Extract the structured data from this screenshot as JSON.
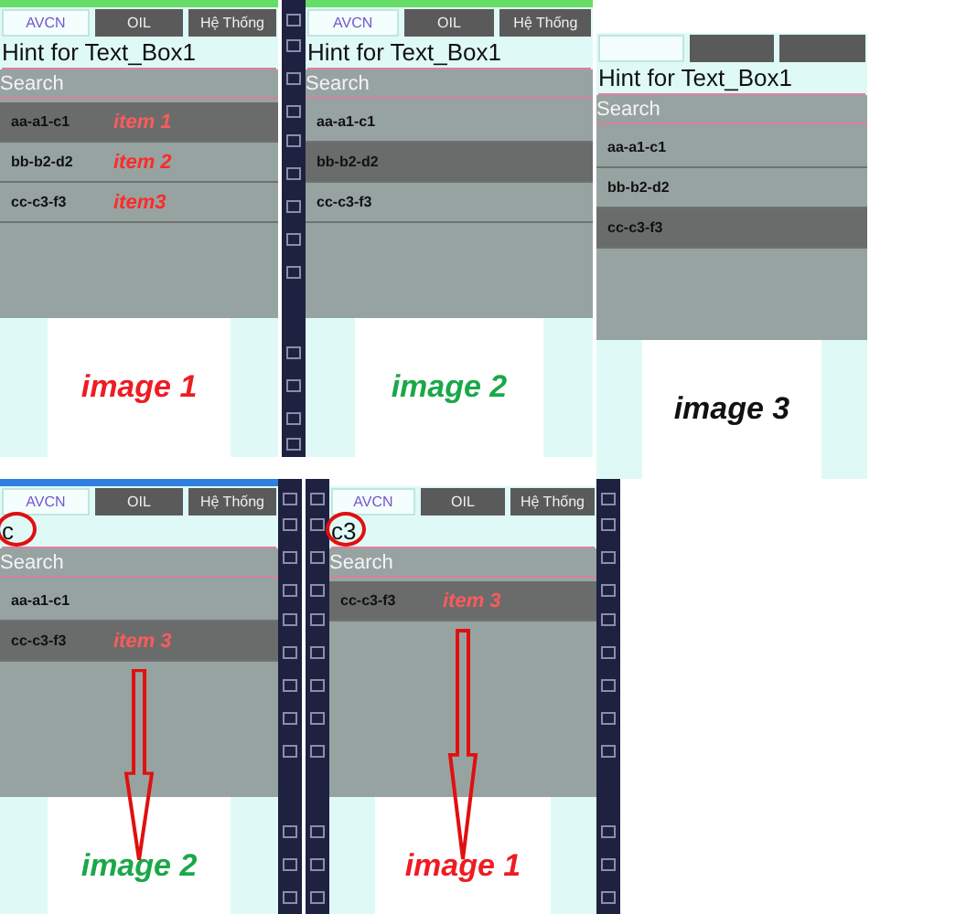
{
  "panels": [
    {
      "tabs": [
        {
          "label": "AVCN",
          "selected": true
        },
        {
          "label": "OIL",
          "selected": false
        },
        {
          "label": "Hệ Thống",
          "selected": false
        }
      ],
      "field": {
        "placeholder": "Hint for Text_Box1"
      },
      "search": {
        "placeholder": "Search"
      },
      "items": [
        {
          "label": "aa-a1-c1",
          "selected": true,
          "note": "item 1"
        },
        {
          "label": "bb-b2-d2",
          "selected": false,
          "note": "item 2"
        },
        {
          "label": "cc-c3-f3",
          "selected": false,
          "note": "item3"
        }
      ],
      "caption": {
        "text": "image 1",
        "color": "#ee1c24"
      }
    },
    {
      "tabs": [
        {
          "label": "AVCN",
          "selected": true
        },
        {
          "label": "OIL",
          "selected": false
        },
        {
          "label": "Hệ Thống",
          "selected": false
        }
      ],
      "field": {
        "placeholder": "Hint for Text_Box1"
      },
      "search": {
        "placeholder": "Search"
      },
      "items": [
        {
          "label": "aa-a1-c1",
          "selected": false
        },
        {
          "label": "bb-b2-d2",
          "selected": true
        },
        {
          "label": "cc-c3-f3",
          "selected": false
        }
      ],
      "caption": {
        "text": "image 2",
        "color": "#1aa84a"
      }
    },
    {
      "tabs": [
        {
          "selected": true
        },
        {
          "selected": false
        },
        {
          "selected": false
        }
      ],
      "field": {
        "placeholder": "Hint for Text_Box1"
      },
      "search": {
        "placeholder": "Search"
      },
      "items": [
        {
          "label": "aa-a1-c1",
          "selected": false
        },
        {
          "label": "bb-b2-d2",
          "selected": false
        },
        {
          "label": "cc-c3-f3",
          "selected": true
        }
      ],
      "caption": {
        "text": "image 3",
        "color": "#111111"
      }
    },
    {
      "tabs": [
        {
          "label": "AVCN",
          "selected": true
        },
        {
          "label": "OIL",
          "selected": false
        },
        {
          "label": "Hệ Thống",
          "selected": false
        }
      ],
      "field": {
        "value": "c",
        "circled": true
      },
      "search": {
        "placeholder": "Search"
      },
      "items": [
        {
          "label": "aa-a1-c1",
          "selected": false
        },
        {
          "label": "cc-c3-f3",
          "selected": true,
          "note": "item 3"
        }
      ],
      "caption": {
        "text": "image 2",
        "color": "#1aa84a"
      },
      "arrow": true
    },
    {
      "tabs": [
        {
          "label": "AVCN",
          "selected": true
        },
        {
          "label": "OIL",
          "selected": false
        },
        {
          "label": "Hệ Thống",
          "selected": false
        }
      ],
      "field": {
        "value": "c3",
        "circled": true
      },
      "search": {
        "placeholder": "Search"
      },
      "items": [
        {
          "label": "cc-c3-f3",
          "selected": true,
          "note": "item 3"
        }
      ],
      "caption": {
        "text": "image 1",
        "color": "#ee1c24"
      },
      "arrow": true
    }
  ]
}
